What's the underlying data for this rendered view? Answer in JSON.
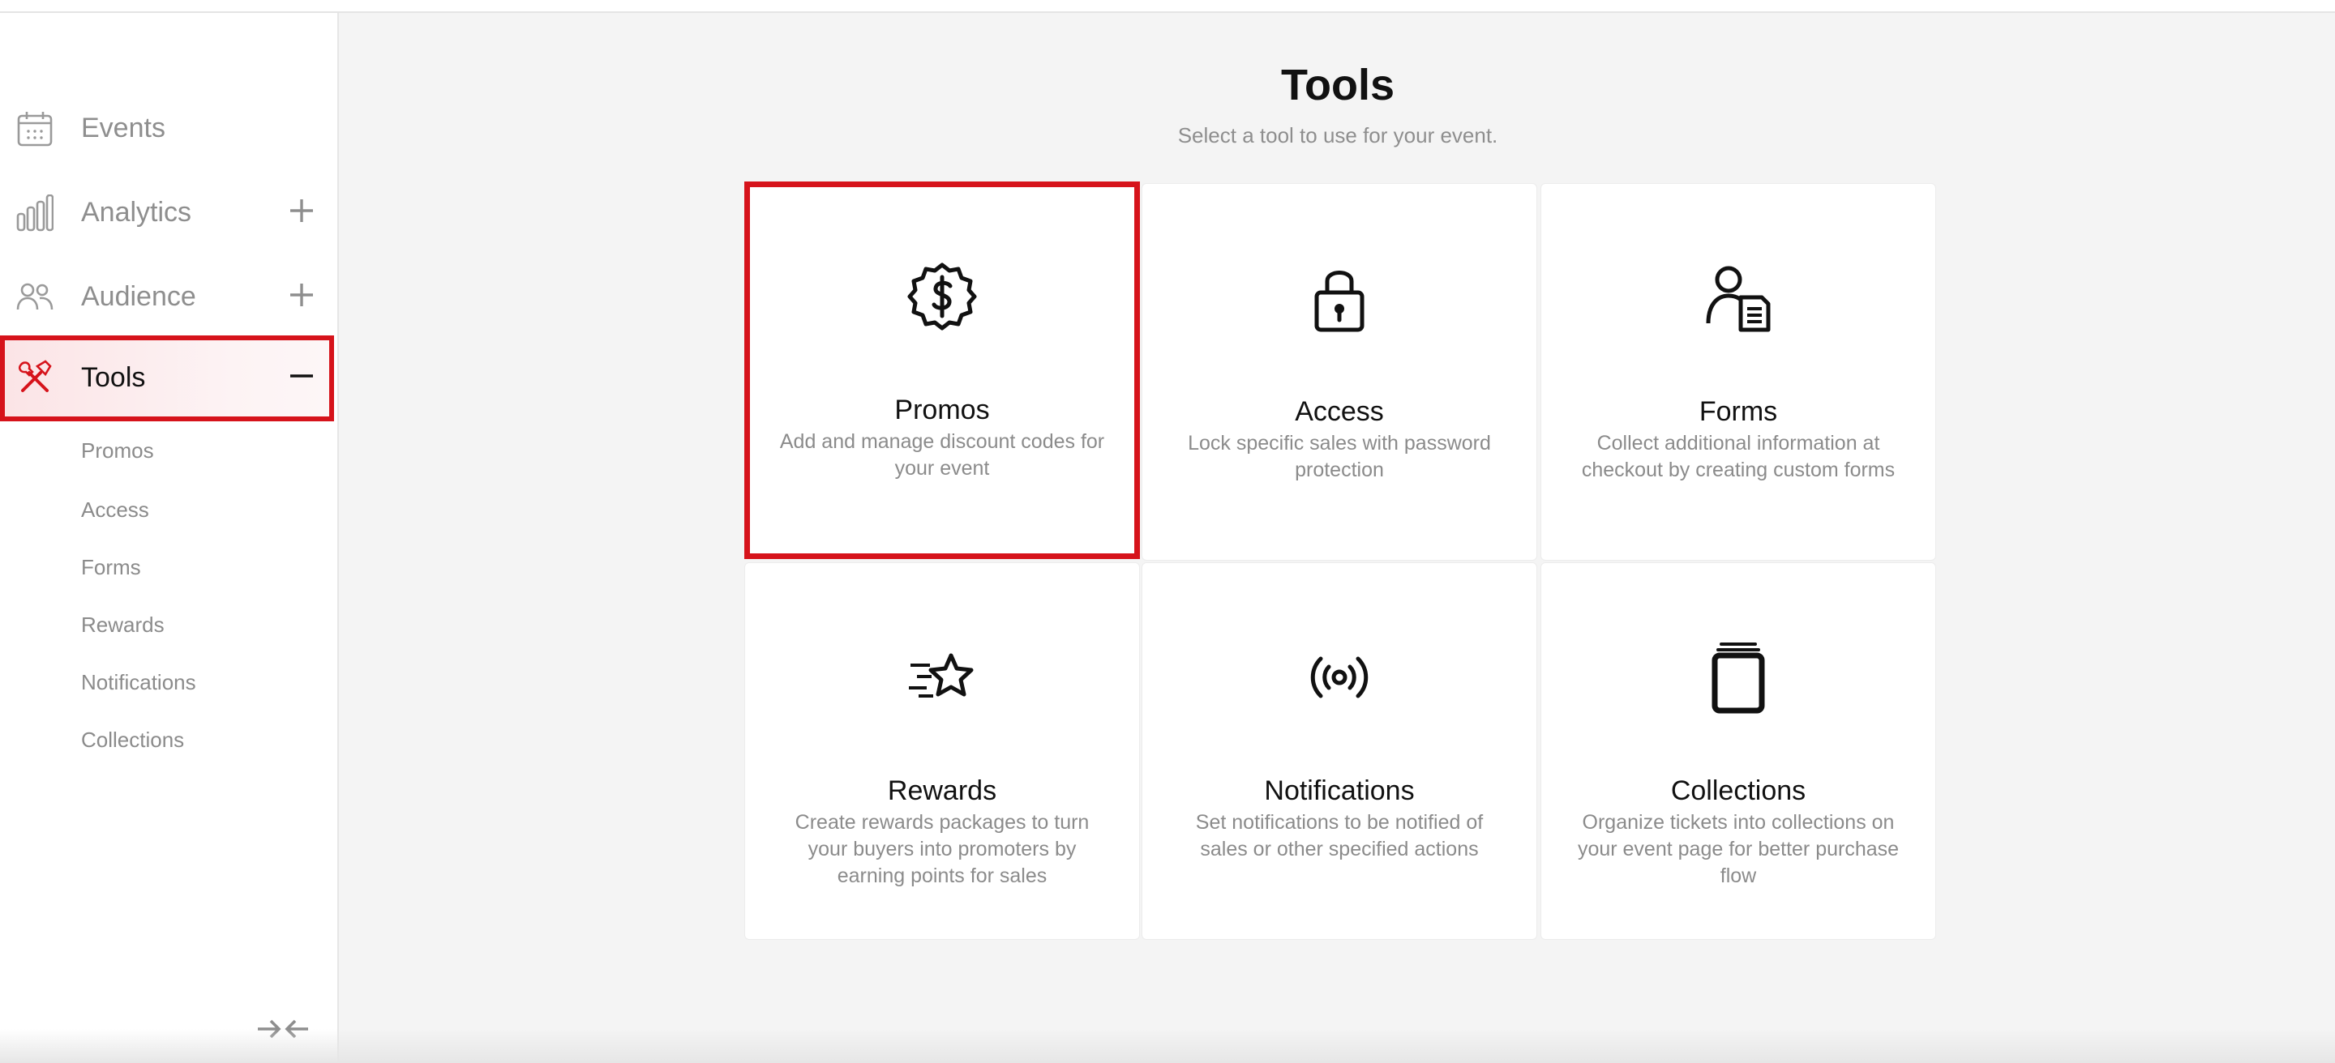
{
  "sidebar": {
    "items": [
      {
        "label": "Events",
        "icon": "calendar-icon",
        "toggle": ""
      },
      {
        "label": "Analytics",
        "icon": "bar-chart-icon",
        "toggle": "+"
      },
      {
        "label": "Audience",
        "icon": "users-icon",
        "toggle": "+"
      },
      {
        "label": "Tools",
        "icon": "tools-icon",
        "toggle": "−",
        "active": true
      }
    ],
    "sub_items": [
      "Promos",
      "Access",
      "Forms",
      "Rewards",
      "Notifications",
      "Collections"
    ],
    "collapse_icon": "collapse-arrows-icon"
  },
  "main": {
    "title": "Tools",
    "subtitle": "Select a tool to use for your event.",
    "cards": [
      {
        "title": "Promos",
        "desc": "Add and manage discount codes for your event",
        "icon": "dollar-badge-icon"
      },
      {
        "title": "Access",
        "desc": "Lock specific sales with password protection",
        "icon": "lock-icon"
      },
      {
        "title": "Forms",
        "desc": "Collect additional information at checkout by creating custom forms",
        "icon": "user-form-icon"
      },
      {
        "title": "Rewards",
        "desc": "Create rewards packages to turn your buyers into promoters by earning points for sales",
        "icon": "star-icon"
      },
      {
        "title": "Notifications",
        "desc": "Set notifications to be notified of sales or other specified actions",
        "icon": "broadcast-icon"
      },
      {
        "title": "Collections",
        "desc": "Organize tickets into collections on your event page for better purchase flow",
        "icon": "stack-icon"
      }
    ]
  },
  "colors": {
    "accent": "#d6131b",
    "muted": "#8e8e8e"
  }
}
